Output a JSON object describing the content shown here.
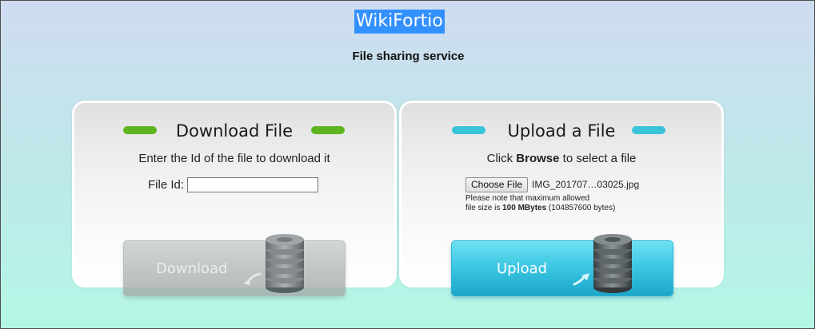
{
  "header": {
    "title": "WikiFortio",
    "subtitle": "File sharing service"
  },
  "download": {
    "heading": "Download File",
    "instruction": "Enter the Id of the file to download it",
    "file_id_label": "File Id:",
    "file_id_value": "",
    "button_label": "Download",
    "accent_color": "#5db520"
  },
  "upload": {
    "heading": "Upload a File",
    "instruction_prefix": "Click ",
    "instruction_bold": "Browse",
    "instruction_suffix": " to select a file",
    "choose_button_label": "Choose File",
    "selected_file": "IMG_201707…03025.jpg",
    "note_line1": "Please note that maximum allowed",
    "note_line2_prefix": "file size is ",
    "note_line2_bold": "100 MBytes",
    "note_line2_suffix": " (104857600 bytes)",
    "button_label": "Upload",
    "accent_color": "#3cc3dc"
  },
  "icons": {
    "database": "database-stack-icon",
    "download_arrow": "arrow-icon",
    "upload_arrow": "arrow-icon"
  }
}
